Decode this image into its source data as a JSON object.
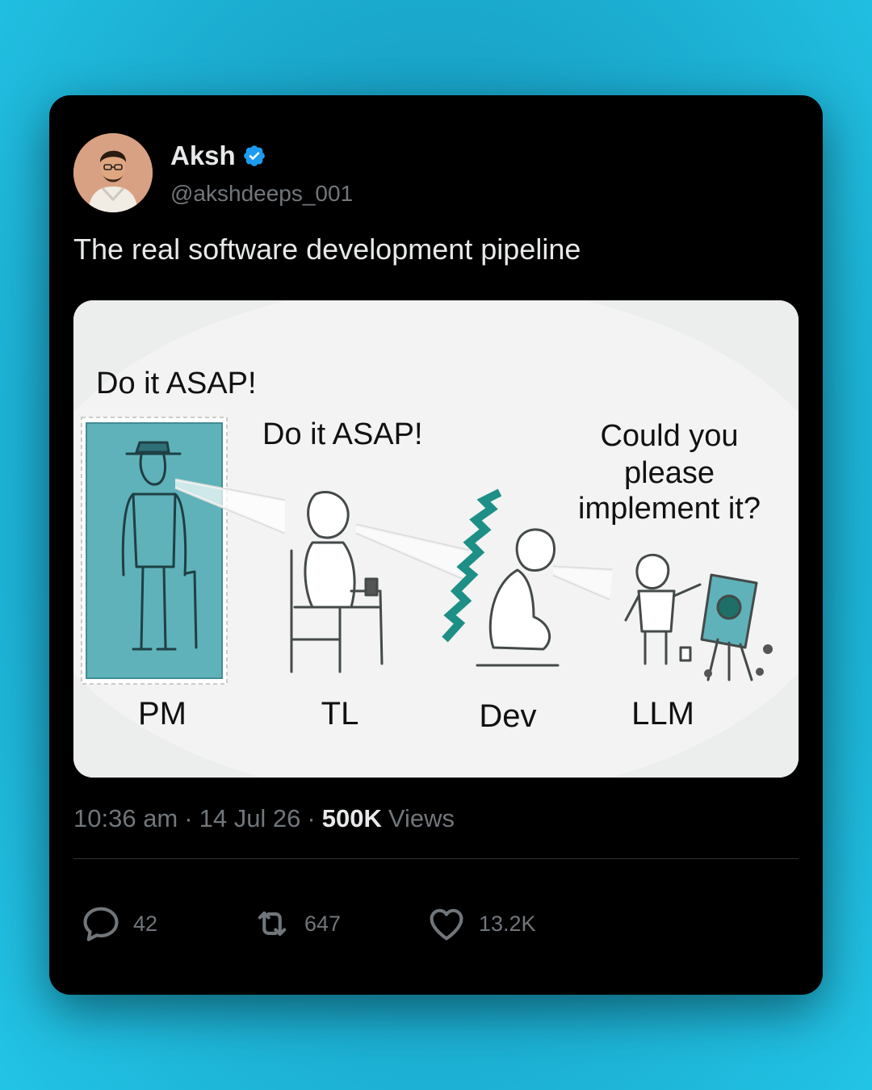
{
  "author": {
    "name": "Aksh",
    "handle": "@akshdeeps_001",
    "verified": true,
    "verified_color": "#1d9bf0"
  },
  "tweet": {
    "text": "The real software development pipeline"
  },
  "image": {
    "captions": {
      "pm_speech": "Do it ASAP!",
      "tl_speech": "Do it ASAP!",
      "dev_speech_line1": "Could you",
      "dev_speech_line2": "please",
      "dev_speech_line3": "implement it?"
    },
    "labels": {
      "pm": "PM",
      "tl": "TL",
      "dev": "Dev",
      "llm": "LLM"
    }
  },
  "meta": {
    "time": "10:36 am",
    "separator": "·",
    "date": "14 Jul 26",
    "views_count": "500K",
    "views_label": "Views"
  },
  "actions": {
    "replies": "42",
    "retweets": "647",
    "likes": "13.2K"
  },
  "icons": {
    "reply": "speech-bubble-icon",
    "retweet": "retweet-arrows-icon",
    "like": "heart-icon",
    "verified": "verified-badge-icon"
  }
}
